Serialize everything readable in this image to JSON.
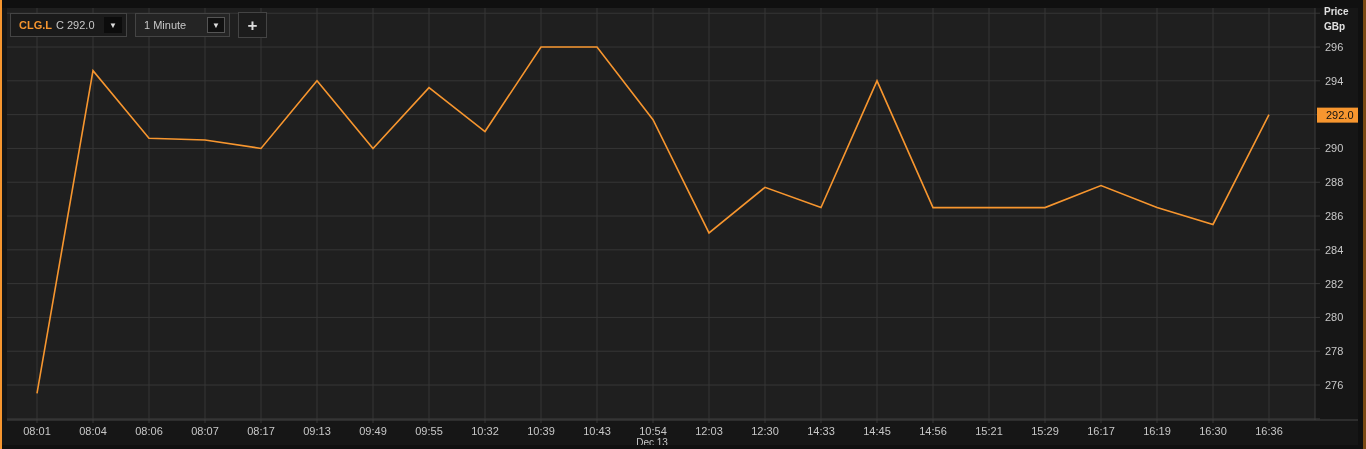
{
  "toolbar": {
    "symbol": {
      "quote": "C 292.0",
      "caret": "▼"
    },
    "interval": {
      "value": "1 Minute",
      "caret": "▼"
    },
    "add_button": "+"
  },
  "axis_header": {
    "title": "Price",
    "unit": "GBp"
  },
  "price_marker": {
    "label": "292.0"
  },
  "chart": {
    "chart_data": {
      "type": "line",
      "xlabel": "Dec 13",
      "categories": [
        "08:01",
        "08:04",
        "08:06",
        "08:07",
        "08:17",
        "09:13",
        "09:49",
        "09:55",
        "10:32",
        "10:39",
        "10:43",
        "10:54",
        "12:03",
        "12:30",
        "14:33",
        "14:45",
        "14:56",
        "15:21",
        "15:29",
        "16:17",
        "16:19",
        "16:30",
        "16:36"
      ],
      "series": [
        {
          "name": "CLG.L",
          "color": "#f7962f",
          "values": [
            275.5,
            294.6,
            290.6,
            290.5,
            290.0,
            294.0,
            290.0,
            293.6,
            291.0,
            296.0,
            296.0,
            291.7,
            285.0,
            287.7,
            286.5,
            294.0,
            286.5,
            286.5,
            286.5,
            287.8,
            286.5,
            285.5,
            292.0
          ]
        }
      ],
      "ylim": [
        273.93,
        298.31
      ],
      "grid": true,
      "yticks": [
        276,
        278,
        280,
        282,
        284,
        286,
        288,
        290,
        294,
        296
      ]
    }
  }
}
